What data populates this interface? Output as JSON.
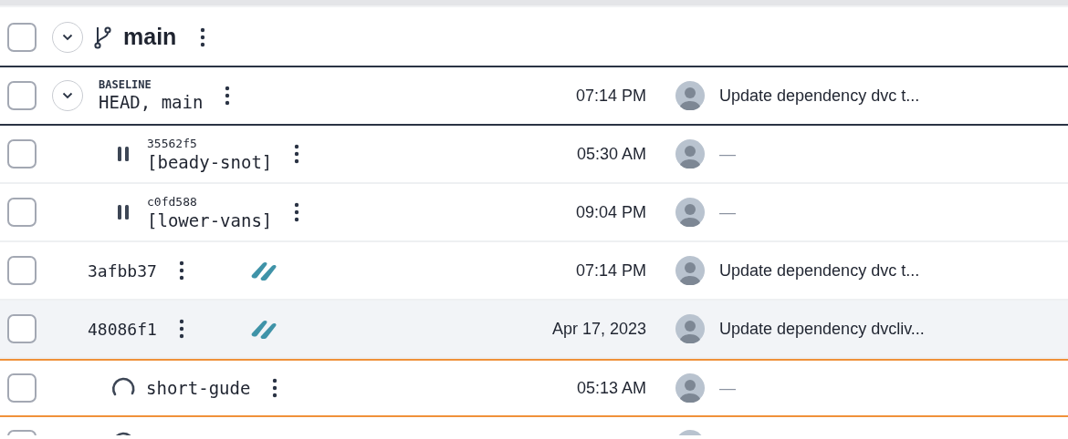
{
  "rows": [
    {
      "kind": "branch",
      "checked": false,
      "expanded": true,
      "name": "main"
    },
    {
      "kind": "baseline",
      "checked": false,
      "expanded": true,
      "label": "BASELINE",
      "name": "HEAD, main",
      "time": "07:14 PM",
      "message": "Update dependency dvc t..."
    },
    {
      "kind": "checkpoint",
      "checked": false,
      "sha": "35562f5",
      "name": "[beady-snot]",
      "time": "05:30 AM",
      "message": "—"
    },
    {
      "kind": "checkpoint",
      "checked": false,
      "sha": "c0fd588",
      "name": "[lower-vans]",
      "time": "09:04 PM",
      "message": "—"
    },
    {
      "kind": "commit",
      "checked": false,
      "hovered": false,
      "highlighted": false,
      "sha": "3afbb37",
      "time": "07:14 PM",
      "message": "Update dependency dvc t..."
    },
    {
      "kind": "commit",
      "checked": false,
      "hovered": true,
      "highlighted": false,
      "sha": "48086f1",
      "time": "Apr 17, 2023",
      "message": "Update dependency dvcliv..."
    },
    {
      "kind": "experiment",
      "checked": false,
      "hovered": false,
      "highlighted": true,
      "name": "short-gude",
      "time": "05:13 AM",
      "message": "—"
    },
    {
      "kind": "experiment",
      "checked": false,
      "hovered": false,
      "highlighted": false
    }
  ]
}
